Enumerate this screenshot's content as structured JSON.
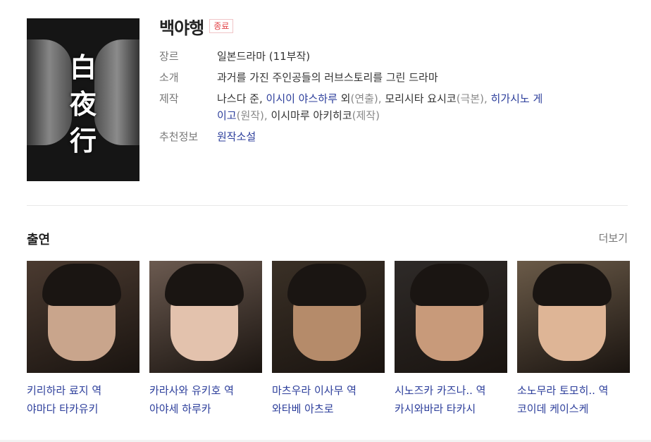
{
  "show": {
    "title": "백야행",
    "status_badge": "종료",
    "poster_title_kanji": [
      "白",
      "夜",
      "行"
    ]
  },
  "info": [
    {
      "label": "장르",
      "value": "일본드라마 (11부작)"
    },
    {
      "label": "소개",
      "value": "과거를 가진 주인공들의 러브스토리를 그린 드라마"
    },
    {
      "label": "제작",
      "line1": [
        "나스다 준, ",
        "이시이 야스하루",
        " 외",
        "(연출), ",
        "모리시타 요시코",
        "(극본), ",
        "히가시노 게"
      ],
      "line2": [
        "이고",
        "(원작), ",
        "이시마루 아키히코",
        "(제작)"
      ]
    },
    {
      "label": "추천정보",
      "value": "원작소설"
    }
  ],
  "cast_section": {
    "title": "출연",
    "more_label": "더보기",
    "members": [
      {
        "role": "키리하라 료지 역",
        "actor": "야마다 타카유키",
        "bg": "#4a3a30",
        "skin": "#c9a58c"
      },
      {
        "role": "카라사와 유키호 역",
        "actor": "아야세 하루카",
        "bg": "#6b5a50",
        "skin": "#e3c2ad"
      },
      {
        "role": "마츠우라 이사무 역",
        "actor": "와타베 아츠로",
        "bg": "#3a3026",
        "skin": "#b58b6a"
      },
      {
        "role": "시노즈카 카즈나.. 역",
        "actor": "카시와바라 타카시",
        "bg": "#2e2a28",
        "skin": "#c89a7a"
      },
      {
        "role": "소노무라 토모히.. 역",
        "actor": "코이데 케이스케",
        "bg": "#6a5a48",
        "skin": "#deb596"
      }
    ]
  }
}
